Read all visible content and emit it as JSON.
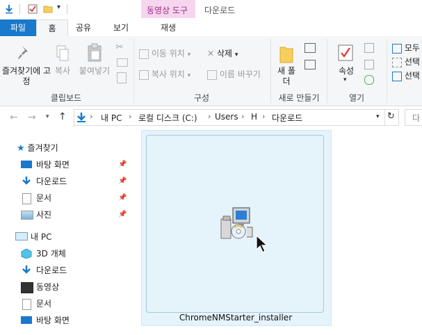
{
  "titlebar": {
    "contextual_tab_header": "동영상 도구",
    "window_title": "다운로드"
  },
  "tabs": {
    "file": "파일",
    "home": "홈",
    "share": "공유",
    "view": "보기",
    "play": "재생"
  },
  "ribbon": {
    "clipboard": {
      "pin_quick_access": "즐겨찾기에 고정",
      "copy": "복사",
      "paste": "붙여넣기",
      "group_label": "클립보드"
    },
    "organize": {
      "move_to": "이동 위치",
      "copy_to": "복사 위치",
      "delete": "삭제",
      "rename": "이름 바꾸기",
      "group_label": "구성"
    },
    "new": {
      "new_folder": "새 폴더",
      "group_label": "새로 만들기"
    },
    "open": {
      "properties": "속성",
      "group_label": "열기"
    },
    "select": {
      "select_all": "모두",
      "select_none": "선택",
      "invert_selection": "선택"
    }
  },
  "address": {
    "crumbs": [
      "내 PC",
      "로컬 디스크 (C:)",
      "Users",
      "H",
      "다운로드"
    ],
    "search_placeholder": "다"
  },
  "nav": {
    "quick_access": "즐겨찾기",
    "qa_items": [
      "바탕 화면",
      "다운로드",
      "문서",
      "사진"
    ],
    "this_pc": "내 PC",
    "pc_items": [
      "3D 개체",
      "다운로드",
      "동영상",
      "문서",
      "바탕 화면"
    ]
  },
  "content": {
    "file_name": "ChromeNMStarter_installer"
  },
  "colors": {
    "accent": "#1979ca",
    "selection_bg": "#e5f3fb",
    "contextual_tab": "#f6d6ee"
  }
}
